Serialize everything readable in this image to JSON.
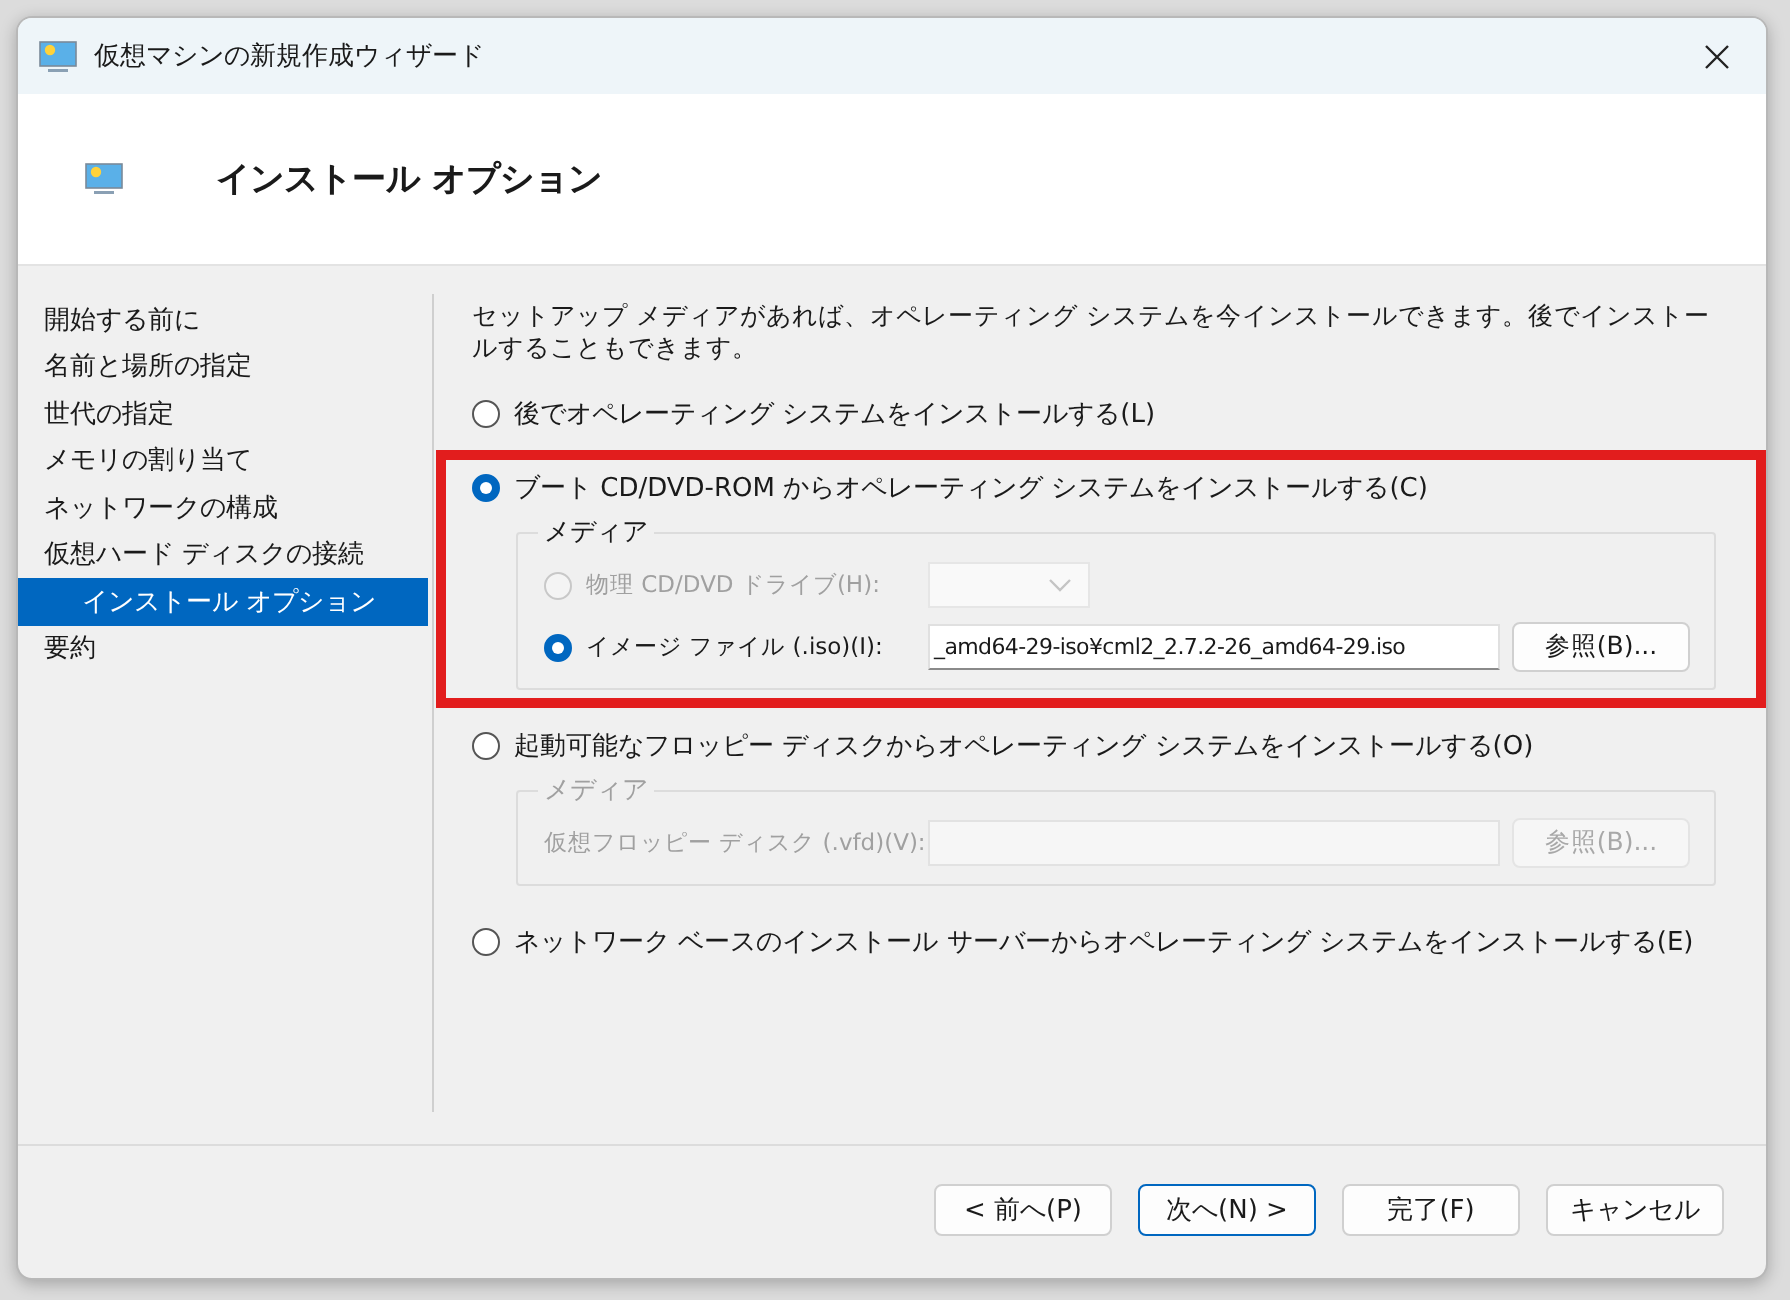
{
  "window": {
    "title": "仮想マシンの新規作成ウィザード"
  },
  "header": {
    "title": "インストール オプション"
  },
  "steps": [
    {
      "label": "開始する前に",
      "selected": false
    },
    {
      "label": "名前と場所の指定",
      "selected": false
    },
    {
      "label": "世代の指定",
      "selected": false
    },
    {
      "label": "メモリの割り当て",
      "selected": false
    },
    {
      "label": "ネットワークの構成",
      "selected": false
    },
    {
      "label": "仮想ハード ディスクの接続",
      "selected": false
    },
    {
      "label": "インストール オプション",
      "selected": true
    },
    {
      "label": "要約",
      "selected": false
    }
  ],
  "intro": "セットアップ メディアがあれば、オペレーティング システムを今インストールできます。後でインストールすることもできます。",
  "options": [
    {
      "label": "後でオペレーティング システムをインストールする(L)",
      "selected": false,
      "highlighted": false
    },
    {
      "label": "ブート CD/DVD-ROM からオペレーティング システムをインストールする(C)",
      "selected": true,
      "highlighted": true,
      "media": {
        "legend": "メディア",
        "disabled": false,
        "rows": [
          {
            "kind": "dropdown",
            "label": "物理 CD/DVD ドライブ(H):",
            "selected": false,
            "disabled": true
          },
          {
            "kind": "file",
            "label": "イメージ ファイル (.iso)(I):",
            "selected": true,
            "disabled": false,
            "value": "_amd64-29-iso¥cml2_2.7.2-26_amd64-29.iso",
            "button": "参照(B)..."
          }
        ]
      }
    },
    {
      "label": "起動可能なフロッピー ディスクからオペレーティング システムをインストールする(O)",
      "selected": false,
      "highlighted": false,
      "media": {
        "legend": "メディア",
        "disabled": true,
        "rows": [
          {
            "kind": "file",
            "label": "仮想フロッピー ディスク (.vfd)(V):",
            "button": "参照(B)..."
          }
        ]
      }
    },
    {
      "label": "ネットワーク ベースのインストール サーバーからオペレーティング システムをインストールする(E)",
      "selected": false,
      "highlighted": false
    }
  ],
  "buttons": [
    {
      "label": "< 前へ(P)",
      "default": false
    },
    {
      "label": "次へ(N) >",
      "default": true
    },
    {
      "label": "完了(F)",
      "default": false
    },
    {
      "label": "キャンセル",
      "default": false
    }
  ]
}
